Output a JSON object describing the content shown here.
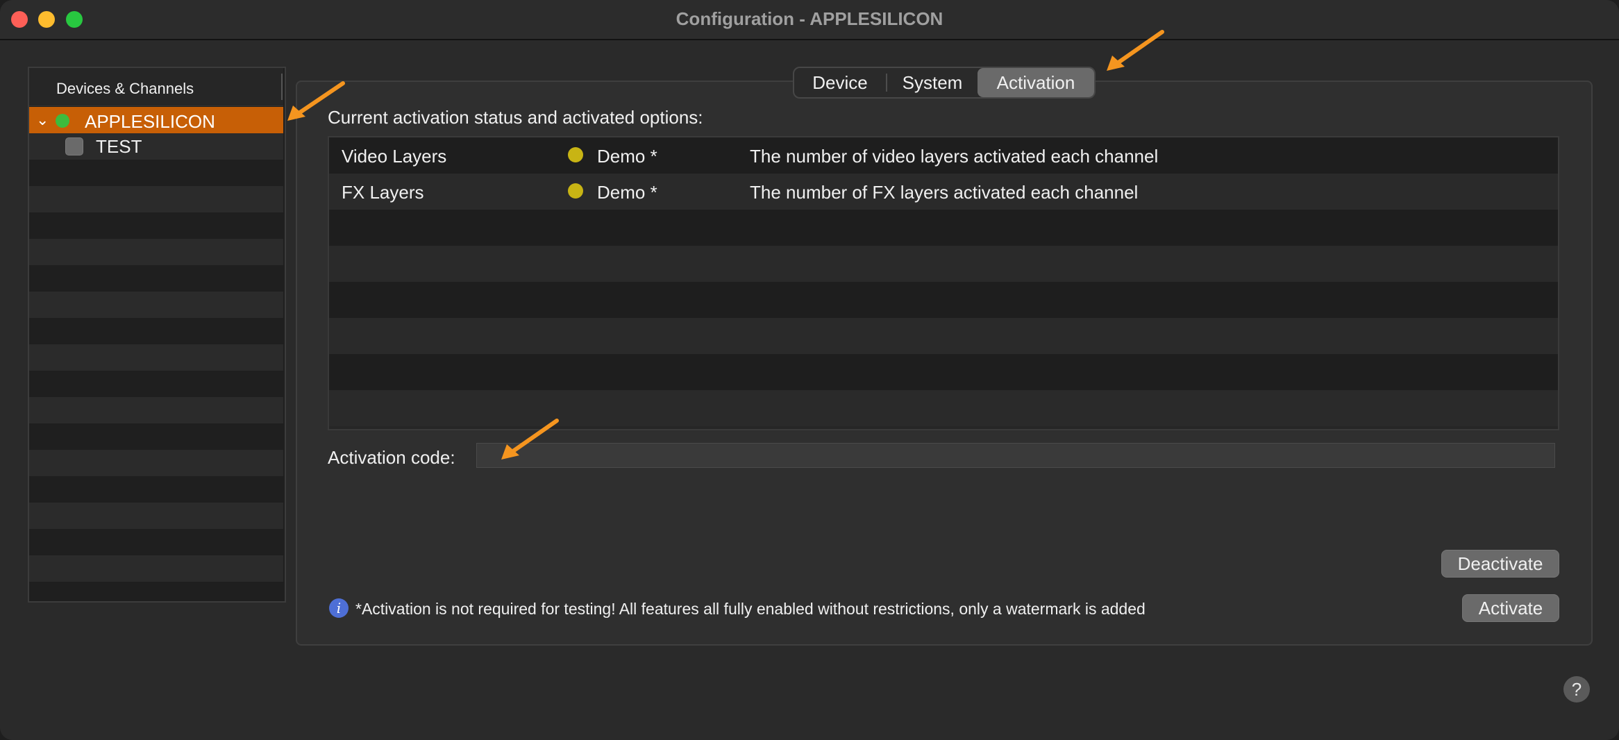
{
  "window": {
    "title": "Configuration - APPLESILICON"
  },
  "sidebar": {
    "header": "Devices & Channels",
    "items": [
      {
        "label": "APPLESILICON",
        "selected": true,
        "expanded": true,
        "status_color": "#3dbb3d"
      },
      {
        "label": "TEST",
        "selected": false,
        "checked": false
      }
    ]
  },
  "tabs": [
    {
      "label": "Device",
      "active": false
    },
    {
      "label": "System",
      "active": false
    },
    {
      "label": "Activation",
      "active": true
    }
  ],
  "activation": {
    "status_label": "Current activation status and activated options:",
    "rows": [
      {
        "name": "Video Layers",
        "status": "Demo *",
        "description": "The number of video layers activated each channel",
        "dot_color": "#c8b414"
      },
      {
        "name": "FX Layers",
        "status": "Demo *",
        "description": "The number of FX layers activated each channel",
        "dot_color": "#c8b414"
      }
    ],
    "code_label": "Activation code:",
    "code_value": "",
    "deactivate_label": "Deactivate",
    "activate_label": "Activate",
    "info_text": "*Activation is not required for testing! All features all fully enabled without restrictions, only a watermark is added"
  },
  "help": {
    "label": "?"
  },
  "colors": {
    "accent_selection": "#c75f06",
    "annotation_arrow": "#f5951f"
  }
}
